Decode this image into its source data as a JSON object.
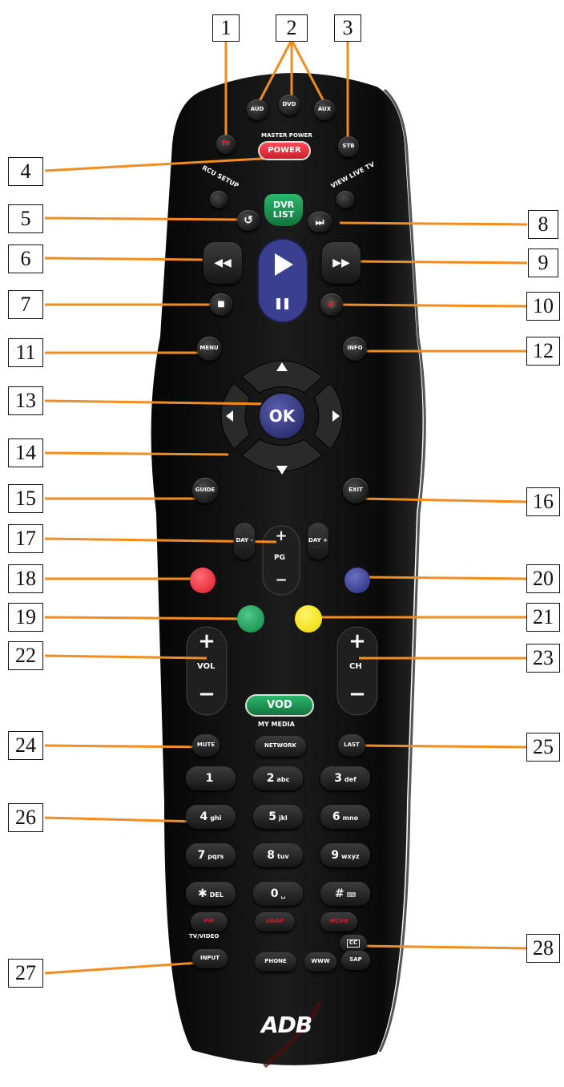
{
  "callouts": [
    "1",
    "2",
    "3",
    "4",
    "5",
    "6",
    "7",
    "8",
    "9",
    "10",
    "11",
    "12",
    "13",
    "14",
    "15",
    "16",
    "17",
    "18",
    "19",
    "20",
    "21",
    "22",
    "23",
    "24",
    "25",
    "26",
    "27",
    "28"
  ],
  "colors": {
    "accent_leader": "#f28c1f",
    "body": "#141414",
    "red": "#e8313f",
    "green": "#1f9a57",
    "yellow": "#f2e21b",
    "blue": "#3a3f8f"
  },
  "remote": {
    "device_labels": [
      "TV",
      "AUD",
      "DVD",
      "AUX",
      "STB"
    ],
    "master_power_label": "MASTER POWER",
    "power_label": "POWER",
    "rcu_setup_label": "RCU SETUP",
    "view_live_tv_label": "VIEW LIVE TV",
    "dvr_list_label": "DVR LIST",
    "menu_label": "MENU",
    "info_label": "INFO",
    "ok_label": "OK",
    "guide_label": "GUIDE",
    "exit_label": "EXIT",
    "day_minus_label": "DAY -",
    "day_plus_label": "DAY +",
    "pg_label": "PG",
    "plus": "+",
    "minus": "−",
    "vol_label": "VOL",
    "ch_label": "CH",
    "vod_label": "VOD",
    "my_media_label": "MY MEDIA",
    "mute_label": "MUTE",
    "network_label": "NETWORK",
    "last_label": "LAST",
    "keypad": [
      {
        "main": "1",
        "sub": ""
      },
      {
        "main": "2",
        "sub": "abc"
      },
      {
        "main": "3",
        "sub": "def"
      },
      {
        "main": "4",
        "sub": "ghi"
      },
      {
        "main": "5",
        "sub": "jkl"
      },
      {
        "main": "6",
        "sub": "mno"
      },
      {
        "main": "7",
        "sub": "pqrs"
      },
      {
        "main": "8",
        "sub": "tuv"
      },
      {
        "main": "9",
        "sub": "wxyz"
      },
      {
        "main": "✱",
        "sub": "DEL"
      },
      {
        "main": "0",
        "sub": "␣"
      },
      {
        "main": "#",
        "sub": "⌨"
      }
    ],
    "pip_label": "PIP",
    "tv_video_label": "TV/VIDEO",
    "swap_label": "SWAP",
    "move_label": "MOVE",
    "cc_label": "CC",
    "input_label": "INPUT",
    "phone_label": "PHONE",
    "www_label": "WWW",
    "sap_label": "SAP",
    "brand": "ADB"
  }
}
